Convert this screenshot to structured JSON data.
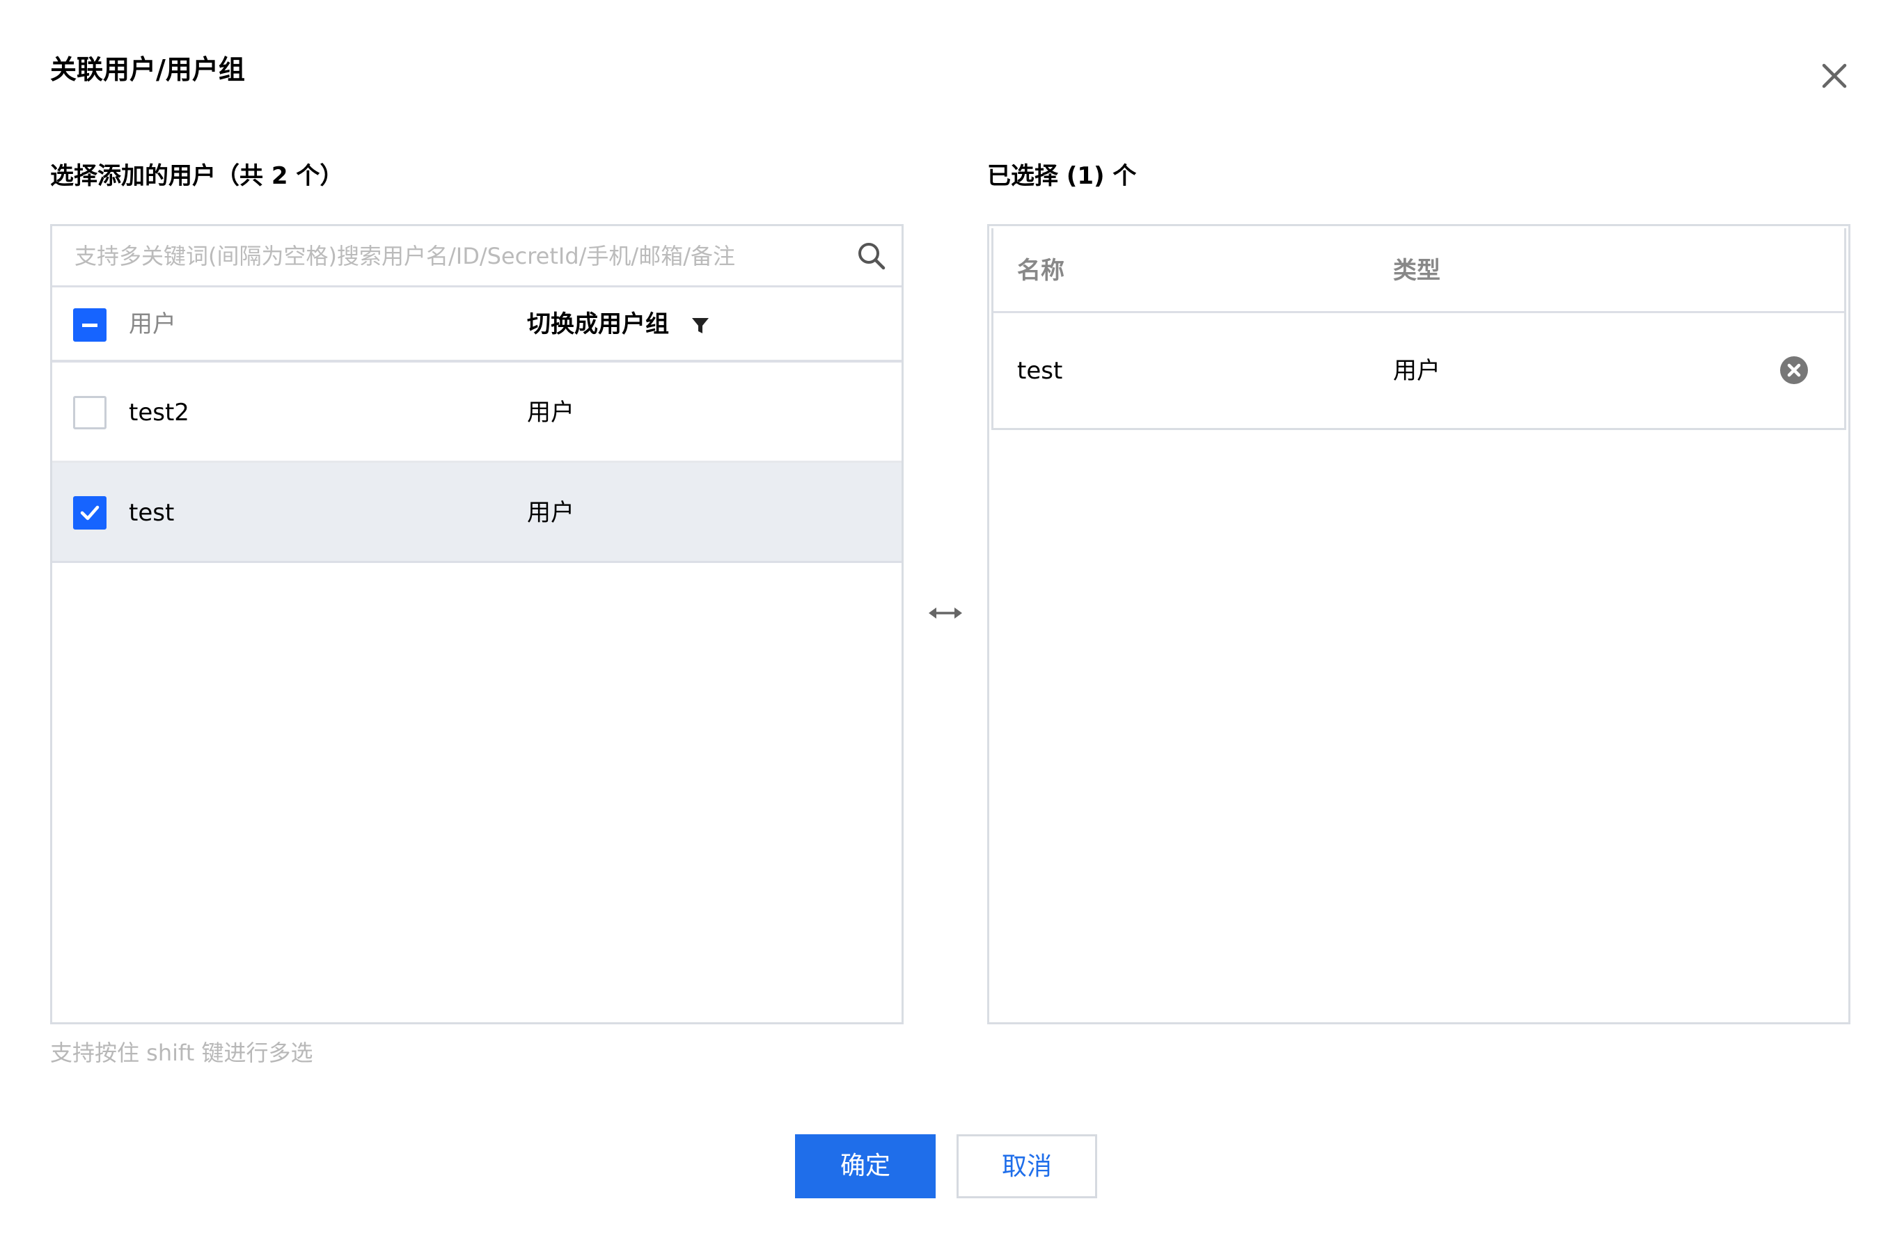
{
  "dialog": {
    "title": "关联用户/用户组",
    "close_icon": "close-icon"
  },
  "left": {
    "label": "选择添加的用户（共 2 个）",
    "search_placeholder": "支持多关键词(间隔为空格)搜索用户名/ID/SecretId/手机/邮箱/备注",
    "header": {
      "select_all_state": "indeterminate",
      "col_user": "用户",
      "col_switch": "切换成用户组"
    },
    "rows": [
      {
        "name": "test2",
        "type": "用户",
        "checked": false
      },
      {
        "name": "test",
        "type": "用户",
        "checked": true
      }
    ],
    "hint": "支持按住 shift 键进行多选"
  },
  "right": {
    "label": "已选择 (1) 个",
    "header": {
      "col_name": "名称",
      "col_type": "类型"
    },
    "rows": [
      {
        "name": "test",
        "type": "用户"
      }
    ]
  },
  "footer": {
    "confirm_label": "确定",
    "cancel_label": "取消"
  },
  "colors": {
    "primary": "#1664ff",
    "button_primary": "#1f6eea",
    "selected_row": "#eaedf2",
    "border": "#d9dde3",
    "muted_text": "#888888"
  }
}
